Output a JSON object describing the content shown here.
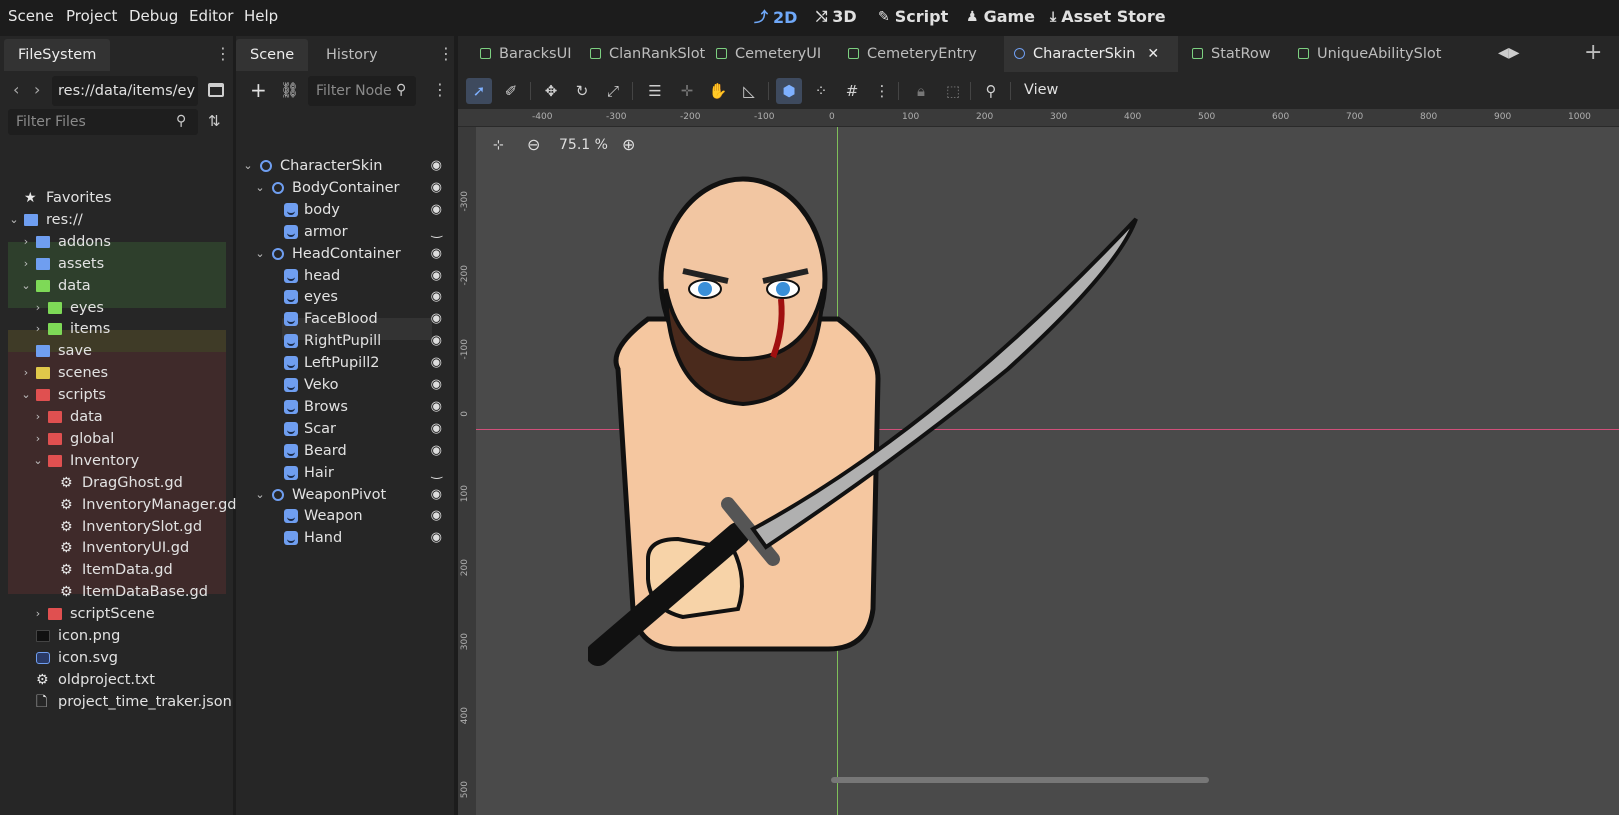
{
  "menu": [
    "Scene",
    "Project",
    "Debug",
    "Editor",
    "Help"
  ],
  "workspaces": [
    {
      "label": "2D",
      "icon": "2d-icon",
      "active": true
    },
    {
      "label": "3D",
      "icon": "3d-icon",
      "active": false
    },
    {
      "label": "Script",
      "icon": "script-icon",
      "active": false
    },
    {
      "label": "Game",
      "icon": "game-icon",
      "active": false
    },
    {
      "label": "Asset Store",
      "icon": "download-icon",
      "active": false
    }
  ],
  "filesystem": {
    "tab": "FileSystem",
    "path": "res://data/items/ey",
    "filter_placeholder": "Filter Files",
    "items": [
      {
        "label": "Favorites",
        "icon": "star-icon"
      },
      {
        "label": "res://",
        "icon": "folder-icon"
      },
      {
        "label": "addons",
        "icon": "folder-icon"
      },
      {
        "label": "assets",
        "icon": "folder-icon"
      },
      {
        "label": "data",
        "icon": "folder-icon"
      },
      {
        "label": "eyes",
        "icon": "folder-icon"
      },
      {
        "label": "items",
        "icon": "folder-icon"
      },
      {
        "label": "save",
        "icon": "folder-icon"
      },
      {
        "label": "scenes",
        "icon": "folder-icon"
      },
      {
        "label": "scripts",
        "icon": "folder-icon"
      },
      {
        "label": "data",
        "icon": "folder-icon"
      },
      {
        "label": "global",
        "icon": "folder-icon"
      },
      {
        "label": "Inventory",
        "icon": "folder-icon"
      },
      {
        "label": "DragGhost.gd",
        "icon": "gear-icon"
      },
      {
        "label": "InventoryManager.gd",
        "icon": "gear-icon"
      },
      {
        "label": "InventorySlot.gd",
        "icon": "gear-icon"
      },
      {
        "label": "InventoryUI.gd",
        "icon": "gear-icon"
      },
      {
        "label": "ItemData.gd",
        "icon": "gear-icon"
      },
      {
        "label": "ItemDataBase.gd",
        "icon": "gear-icon"
      },
      {
        "label": "scriptScene",
        "icon": "folder-icon"
      },
      {
        "label": "icon.png",
        "icon": "image-icon"
      },
      {
        "label": "icon.svg",
        "icon": "svg-icon"
      },
      {
        "label": "oldproject.txt",
        "icon": "gear-icon"
      },
      {
        "label": "project_time_traker.json",
        "icon": "file-icon"
      }
    ]
  },
  "scene": {
    "tabs": [
      "Scene",
      "History"
    ],
    "filter_placeholder": "Filter Node",
    "nodes": [
      {
        "label": "CharacterSkin"
      },
      {
        "label": "BodyContainer"
      },
      {
        "label": "body"
      },
      {
        "label": "armor"
      },
      {
        "label": "HeadContainer"
      },
      {
        "label": "head"
      },
      {
        "label": "eyes"
      },
      {
        "label": "FaceBlood"
      },
      {
        "label": "RightPupill"
      },
      {
        "label": "LeftPupill2"
      },
      {
        "label": "Veko"
      },
      {
        "label": "Brows"
      },
      {
        "label": "Scar"
      },
      {
        "label": "Beard"
      },
      {
        "label": "Hair"
      },
      {
        "label": "WeaponPivot"
      },
      {
        "label": "Weapon"
      },
      {
        "label": "Hand"
      }
    ]
  },
  "doc_tabs": [
    "BaracksUI",
    "ClanRankSlot",
    "CemeteryUI",
    "CemeteryEntry",
    "CharacterSkin",
    "StatRow",
    "UniqueAbilitySlot"
  ],
  "toolbar": {
    "view_label": "View"
  },
  "viewport": {
    "zoom": "75.1 %",
    "ruler_x": [
      "-400",
      "-300",
      "-200",
      "-100",
      "0",
      "100",
      "200",
      "300",
      "400",
      "500",
      "600",
      "700",
      "800",
      "900",
      "1000"
    ],
    "ruler_y": [
      "-300",
      "-200",
      "-100",
      "0",
      "100",
      "200",
      "300",
      "400",
      "500"
    ]
  },
  "colors": {
    "accent": "#6fa8f8",
    "folder_blue": "#6f9ef0",
    "folder_green": "#7ed957",
    "folder_yellow": "#e0c84a",
    "folder_red": "#e05050"
  }
}
